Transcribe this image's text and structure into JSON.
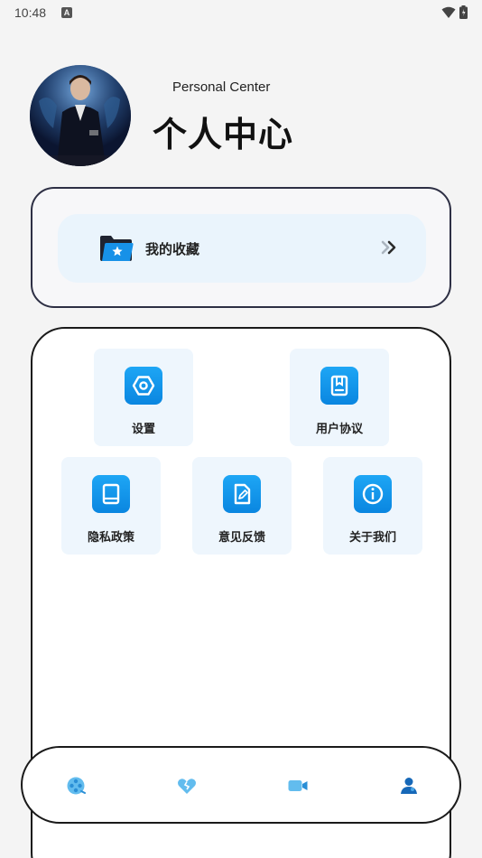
{
  "status_bar": {
    "time": "10:48",
    "a_badge": "A"
  },
  "header": {
    "subtitle": "Personal Center",
    "title": "个人中心",
    "avatar_alt": "avatar"
  },
  "favorites": {
    "label": "我的收藏",
    "icon": "folder-star-icon",
    "chevron": "double-chevron-right-icon"
  },
  "menu": {
    "items": [
      {
        "label": "设置",
        "icon": "settings-icon"
      },
      {
        "label": "用户协议",
        "icon": "agreement-icon"
      },
      {
        "label": "隐私政策",
        "icon": "privacy-book-icon"
      },
      {
        "label": "意见反馈",
        "icon": "feedback-edit-icon"
      },
      {
        "label": "关于我们",
        "icon": "info-icon"
      }
    ]
  },
  "bottom_nav": {
    "items": [
      {
        "icon": "film-reel-icon"
      },
      {
        "icon": "heart-icon"
      },
      {
        "icon": "video-camera-icon"
      },
      {
        "icon": "profile-icon",
        "active": true
      }
    ]
  },
  "colors": {
    "accent": "#0a86e0",
    "light_accent": "#55b8ef",
    "tile_bg": "#eef6fd",
    "row_bg": "#eaf4fc"
  }
}
